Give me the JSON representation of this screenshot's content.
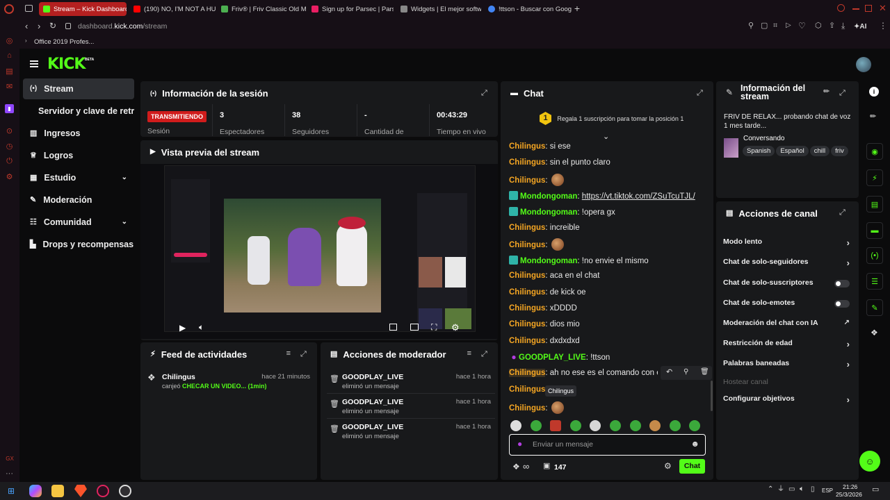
{
  "browser": {
    "tabs": [
      {
        "label": "Stream – Kick Dashboard",
        "color": "#53fc18"
      },
      {
        "label": "(190) NO, I'M NOT A HUM",
        "color": "#ff0000"
      },
      {
        "label": "Friv® | Friv Classic Old Ma",
        "color": "#4caf50"
      },
      {
        "label": "Sign up for Parsec | Parse",
        "color": "#e91e63"
      },
      {
        "label": "Widgets | El mejor softwa",
        "color": "#888888"
      },
      {
        "label": "!ttson - Buscar con Google",
        "color": "#4285f4"
      }
    ],
    "new_tab": "+",
    "url_prefix": "dashboard.",
    "url_domain": "kick.com",
    "url_path": "/stream",
    "bookmark": "Office 2019 Profes...",
    "ai_label": "AI"
  },
  "brand": {
    "logo": "KICK",
    "beta": "BETA"
  },
  "nav": {
    "items": [
      {
        "label": "Stream",
        "icon": "broadcast-icon"
      },
      {
        "label": "Servidor y clave de retransm",
        "icon": ""
      },
      {
        "label": "Ingresos",
        "icon": "chart-icon"
      },
      {
        "label": "Logros",
        "icon": "trophy-icon"
      },
      {
        "label": "Estudio",
        "icon": "studio-icon"
      },
      {
        "label": "Moderación",
        "icon": "wrench-icon"
      },
      {
        "label": "Comunidad",
        "icon": "community-icon"
      },
      {
        "label": "Drops y recompensas",
        "icon": "drops-icon"
      }
    ]
  },
  "session": {
    "title": "Información de la sesión",
    "live_badge": "TRANSMITIENDO",
    "live_label": "Sesión",
    "stats": [
      {
        "value": "3",
        "label": "Espectadores"
      },
      {
        "value": "38",
        "label": "Seguidores"
      },
      {
        "value": "-",
        "label": "Cantidad de"
      },
      {
        "value": "00:43:29",
        "label": "Tiempo en vivo"
      }
    ]
  },
  "preview": {
    "title": "Vista previa del stream"
  },
  "feed": {
    "title": "Feed de actividades",
    "item_user": "Chilingus",
    "item_time": "hace 21 minutos",
    "item_action": "canjeó",
    "item_reward": "CHECAR UN VIDEO... (1min)"
  },
  "modactions": {
    "title": "Acciones de moderador",
    "rows": [
      {
        "name": "GOODPLAY_LIVE",
        "desc": "eliminó un mensaje",
        "time": "hace 1 hora"
      },
      {
        "name": "GOODPLAY_LIVE",
        "desc": "eliminó un mensaje",
        "time": "hace 1 hora"
      },
      {
        "name": "GOODPLAY_LIVE",
        "desc": "eliminó un mensaje",
        "time": "hace 1 hora"
      }
    ]
  },
  "chat": {
    "title": "Chat",
    "gift_rank": "1",
    "gift_text": "Regala 1 suscripción para tomar la posición 1",
    "messages": [
      {
        "user": "Chilingus",
        "text": "si ese",
        "type": "o"
      },
      {
        "user": "Chilingus",
        "text": "sin el punto claro",
        "type": "o"
      },
      {
        "user": "Chilingus",
        "text": "",
        "type": "o",
        "emote": true
      },
      {
        "user": "Mondongoman",
        "text": "https://vt.tiktok.com/ZSuTcuTJL/",
        "type": "g",
        "badge": true,
        "link": true
      },
      {
        "user": "Mondongoman",
        "text": "!opera gx",
        "type": "g",
        "badge": true
      },
      {
        "user": "Chilingus",
        "text": "increible",
        "type": "o"
      },
      {
        "user": "Chilingus",
        "text": "",
        "type": "o",
        "emote": true
      },
      {
        "user": "Mondongoman",
        "text": "!no envie el mismo",
        "type": "g",
        "badge": true
      },
      {
        "user": "Chilingus",
        "text": "aca en el chat",
        "type": "o"
      },
      {
        "user": "Chilingus",
        "text": "de kick oe",
        "type": "o"
      },
      {
        "user": "Chilingus",
        "text": "xDDDD",
        "type": "o"
      },
      {
        "user": "Chilingus",
        "text": "dios mio",
        "type": "o"
      },
      {
        "user": "Chilingus",
        "text": "dxdxdxd",
        "type": "o"
      },
      {
        "user": "GOODPLAY_LIVE",
        "text": "!ttson",
        "type": "g",
        "mic": true
      },
      {
        "user": "Chilingus",
        "text": "ah no ese es el comando con el",
        "type": "o"
      },
      {
        "user": "Chilingus",
        "text": "",
        "type": "o"
      },
      {
        "user": "Chilingus",
        "text": "",
        "type": "o",
        "emote": true
      }
    ],
    "tooltip": "Chilingus",
    "input_placeholder": "Enviar un mensaje",
    "points": "147",
    "send_label": "Chat"
  },
  "streaminfo": {
    "title": "Información del stream",
    "stream_title": "FRIV DE RELAX... probando chat de voz 1 mes tarde...",
    "category": "Conversando",
    "tags": [
      "Spanish",
      "Español",
      "chill",
      "friv"
    ]
  },
  "channel": {
    "title": "Acciones de canal",
    "rows": [
      {
        "label": "Modo lento",
        "kind": "chevron"
      },
      {
        "label": "Chat de solo-seguidores",
        "kind": "chevron"
      },
      {
        "label": "Chat de solo-suscriptores",
        "kind": "toggle"
      },
      {
        "label": "Chat de solo-emotes",
        "kind": "toggle"
      },
      {
        "label": "Moderación del chat con IA",
        "kind": "ext"
      },
      {
        "label": "Restricción de edad",
        "kind": "chevron"
      },
      {
        "label": "Palabras baneadas",
        "kind": "chevron"
      },
      {
        "label": "Hostear canal",
        "kind": "disabled"
      },
      {
        "label": "Configurar objetivos",
        "kind": "chevron"
      }
    ]
  },
  "taskbar": {
    "lang": "ESP",
    "time": "21:26",
    "date": "25/3/2026",
    "gx": "GX"
  },
  "colors": {
    "kick_green": "#53fc18",
    "accent_red": "#b42020",
    "panel": "#18191b"
  }
}
